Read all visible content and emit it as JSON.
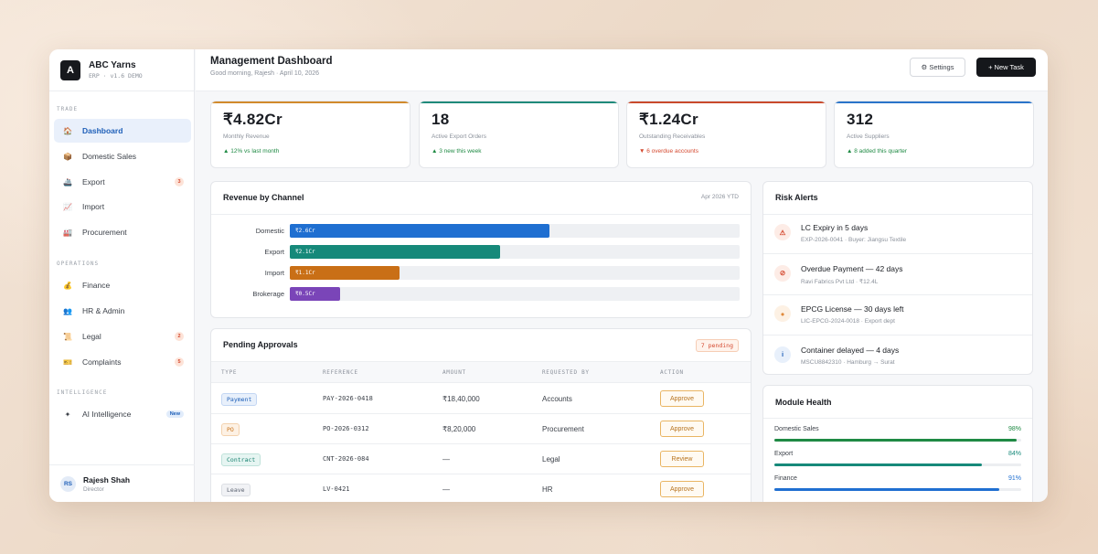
{
  "sidebar": {
    "app_name": "ABC Yarns",
    "app_sub": "ERP · v1.6 DEMO",
    "logo_letter": "A",
    "sections": [
      "TRADE",
      "OPERATIONS",
      "INTELLIGENCE"
    ],
    "items": [
      {
        "label": "Dashboard",
        "icon": "home-icon",
        "active": true
      },
      {
        "label": "Domestic Sales",
        "icon": "box-icon"
      },
      {
        "label": "Export",
        "icon": "ship-icon",
        "badge": "3"
      },
      {
        "label": "Import",
        "icon": "chart-icon"
      },
      {
        "label": "Procurement",
        "icon": "factory-icon"
      },
      {
        "label": "Finance",
        "icon": "money-bag-icon"
      },
      {
        "label": "HR & Admin",
        "icon": "people-icon"
      },
      {
        "label": "Legal",
        "icon": "scroll-icon",
        "badge": "2"
      },
      {
        "label": "Complaints",
        "icon": "ticket-icon",
        "badge": "5"
      },
      {
        "label": "AI Intelligence",
        "icon": "sparkle-icon",
        "badge": "New"
      }
    ],
    "user": {
      "initials": "RS",
      "name": "Rajesh Shah",
      "role": "Director"
    }
  },
  "header": {
    "title": "Management Dashboard",
    "subtitle": "Good morning, Rajesh · April 10, 2026",
    "settings_label": "⚙ Settings",
    "new_task_label": "+ New Task"
  },
  "kpis": [
    {
      "value": "₹4.82Cr",
      "label": "Monthly Revenue",
      "change": "▲ 12% vs last month",
      "trend": "up",
      "color": "#d18a2c"
    },
    {
      "value": "18",
      "label": "Active Export Orders",
      "change": "▲ 3 new this week",
      "trend": "up",
      "color": "#1f8a7a"
    },
    {
      "value": "₹1.24Cr",
      "label": "Outstanding Receivables",
      "change": "▼ 6 overdue accounts",
      "trend": "down",
      "color": "#c94a2c"
    },
    {
      "value": "312",
      "label": "Active Suppliers",
      "change": "▲ 8 added this quarter",
      "trend": "up",
      "color": "#2a74c9"
    }
  ],
  "revenue": {
    "title": "Revenue by Channel",
    "period": "Apr 2026 YTD",
    "channels": [
      {
        "name": "Domestic",
        "label": "₹2.6Cr",
        "value": 2.6,
        "color": "#1f6fd1"
      },
      {
        "name": "Export",
        "label": "₹2.1Cr",
        "value": 2.1,
        "color": "#16897a"
      },
      {
        "name": "Import",
        "label": "₹1.1Cr",
        "value": 1.1,
        "color": "#c96f16"
      },
      {
        "name": "Brokerage",
        "label": "₹0.5Cr",
        "value": 0.5,
        "color": "#7a45b8"
      }
    ],
    "max": 4.5
  },
  "approvals": {
    "title": "Pending Approvals",
    "pending": "7 pending",
    "columns": [
      "TYPE",
      "REFERENCE",
      "AMOUNT",
      "REQUESTED BY",
      "ACTION"
    ],
    "rows": [
      {
        "type": "Payment",
        "ref": "PAY-2026-0418",
        "amount": "₹18,40,000",
        "by": "Accounts",
        "action": "Approve",
        "tag_color": "#1e5fb8",
        "tag_bg": "#e8f0fb",
        "tag_border": "#c3d6f3"
      },
      {
        "type": "PO",
        "ref": "PO-2026-0312",
        "amount": "₹8,20,000",
        "by": "Procurement",
        "action": "Approve",
        "tag_color": "#c9741c",
        "tag_bg": "#fdf1e4",
        "tag_border": "#f3d2ae"
      },
      {
        "type": "Contract",
        "ref": "CNT-2026-084",
        "amount": "—",
        "by": "Legal",
        "action": "Review",
        "tag_color": "#16806f",
        "tag_bg": "#e6f5f2",
        "tag_border": "#bfe2da"
      },
      {
        "type": "Leave",
        "ref": "LV-0421",
        "amount": "—",
        "by": "HR",
        "action": "Approve",
        "tag_color": "#5a6270",
        "tag_bg": "#f1f2f5",
        "tag_border": "#dcdfe4"
      }
    ]
  },
  "risk": {
    "title": "Risk Alerts",
    "alerts": [
      {
        "icon": "warning-icon",
        "glyph": "⚠",
        "title": "LC Expiry in 5 days",
        "sub": "EXP-2026-0041 · Buyer: Jiangsu Textile",
        "color": "#d4482e",
        "bg": "#fdece6"
      },
      {
        "icon": "clock-icon",
        "glyph": "⊘",
        "title": "Overdue Payment — 42 days",
        "sub": "Ravi Fabrics Pvt Ltd · ₹12.4L",
        "color": "#d4482e",
        "bg": "#fdece6"
      },
      {
        "icon": "license-icon",
        "glyph": "●",
        "title": "EPCG License — 30 days left",
        "sub": "LIC-EPCG-2024-0018 · Export dept",
        "color": "#e08a3c",
        "bg": "#fdf1e4"
      },
      {
        "icon": "info-icon",
        "glyph": "i",
        "title": "Container delayed — 4 days",
        "sub": "MSCU8842310 · Hamburg → Surat",
        "color": "#1e5fb8",
        "bg": "#e8f0fb"
      }
    ]
  },
  "health": {
    "title": "Module Health",
    "modules": [
      {
        "name": "Domestic Sales",
        "pct": "98%",
        "value": 0.98,
        "color": "#1f8a44"
      },
      {
        "name": "Export",
        "pct": "84%",
        "value": 0.84,
        "color": "#16897a"
      },
      {
        "name": "Finance",
        "pct": "91%",
        "value": 0.91,
        "color": "#1f6fd1"
      }
    ]
  }
}
